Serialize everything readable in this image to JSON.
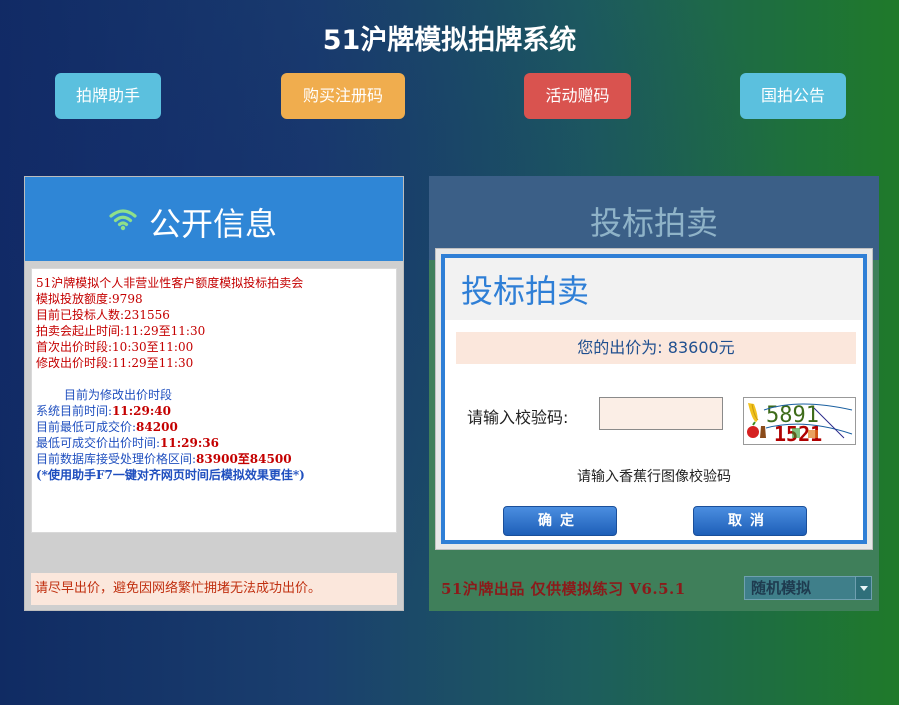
{
  "header": {
    "title": "51沪牌模拟拍牌系统",
    "buttons": [
      "拍牌助手",
      "购买注册码",
      "活动赠码",
      "国拍公告"
    ]
  },
  "left_panel": {
    "title": "公开信息",
    "icon": "wifi-icon",
    "lines": [
      "51沪牌模拟个人非营业性客户额度模拟投标拍卖会",
      "模拟投放额度:9798",
      "目前已投标人数:231556",
      "拍卖会起止时间:11:29至11:30",
      "首次出价时段:10:30至11:00",
      "修改出价时段:11:29至11:30"
    ],
    "status_line": "目前为修改出价时段",
    "system_time_label": "系统目前时间:",
    "system_time_value": "11:29:40",
    "min_price_label": "目前最低可成交价:",
    "min_price_value": "84200",
    "min_price_time_label": "最低可成交价出价时间:",
    "min_price_time_value": "11:29:36",
    "range_label": "目前数据库接受处理价格区间:",
    "range_value": "83900至84500",
    "tip_line": "(*使用助手F7一键对齐网页时间后模拟效果更佳*)",
    "footer": "请尽早出价，避免因网络繁忙拥堵无法成功出价。"
  },
  "right_panel": {
    "title": "投标拍卖",
    "dialog_title": "投标拍卖",
    "price_text": "您的出价为: 83600元",
    "captcha_label": "请输入校验码:",
    "captcha_value": "",
    "captcha_chars": "5891",
    "captcha_chars2": "1521",
    "captcha_hint": "请输入香蕉行图像校验码",
    "confirm_label": "确定",
    "cancel_label": "取消",
    "footer": "51沪牌出品 仅供模拟练习 V6.5.1",
    "mode_select": "随机模拟"
  }
}
